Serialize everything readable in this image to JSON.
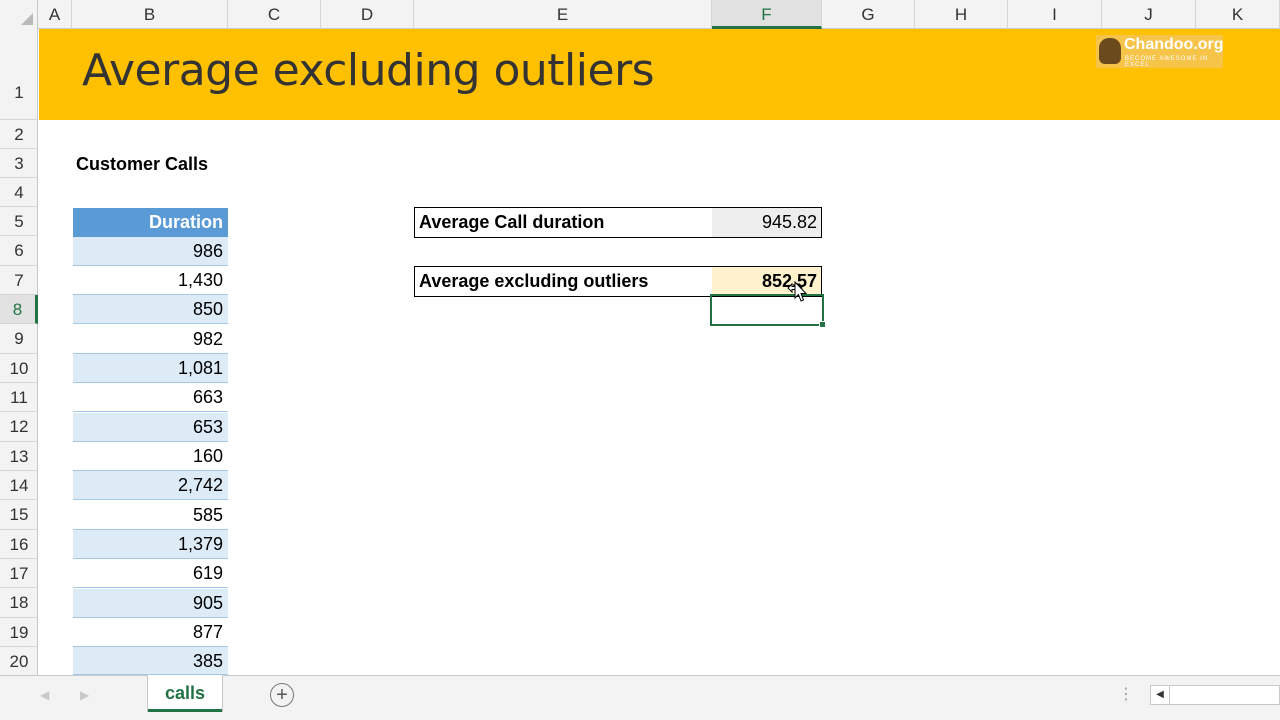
{
  "columns": [
    "A",
    "B",
    "C",
    "D",
    "E",
    "F",
    "G",
    "H",
    "I",
    "J",
    "K"
  ],
  "selected_column": "F",
  "rows": [
    "1",
    "2",
    "3",
    "4",
    "5",
    "6",
    "7",
    "8",
    "9",
    "10",
    "11",
    "12",
    "13",
    "14",
    "15",
    "16",
    "17",
    "18",
    "19",
    "20"
  ],
  "selected_row": "8",
  "title": "Average excluding outliers",
  "logo": {
    "name": "Chandoo.org",
    "tagline": "BECOME AWESOME IN EXCEL"
  },
  "section_label": "Customer Calls",
  "table": {
    "header": "Duration",
    "values": [
      "986",
      "1,430",
      "850",
      "982",
      "1,081",
      "663",
      "653",
      "160",
      "2,742",
      "585",
      "1,379",
      "619",
      "905",
      "877",
      "385"
    ]
  },
  "summary": {
    "avg_call_label": "Average Call duration",
    "avg_call_value": "945.82",
    "avg_excl_label": "Average excluding outliers",
    "avg_excl_value": "852.57"
  },
  "sheet_tabs": [
    "calls"
  ],
  "active_tab": "calls",
  "colors": {
    "title_band": "#ffc000",
    "table_header": "#5b9bd5",
    "band_row": "#ddebf7",
    "highlight_result": "#fff2cc",
    "excel_green": "#217346"
  }
}
